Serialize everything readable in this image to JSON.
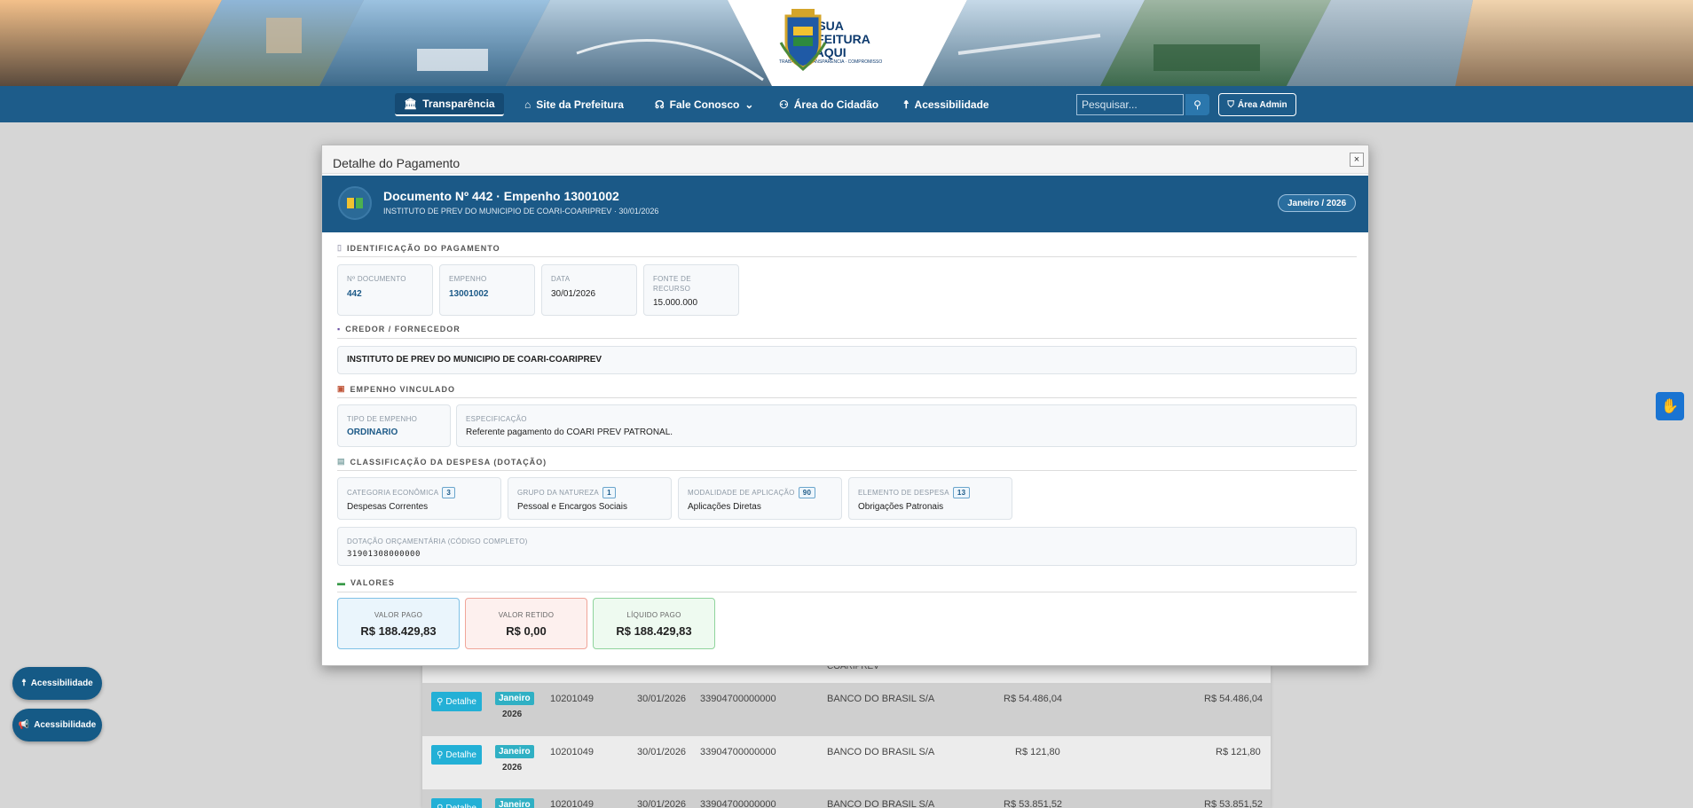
{
  "nav": {
    "items": [
      {
        "label": "Transparência",
        "icon": "bank-icon"
      },
      {
        "label": "Site da Prefeitura",
        "icon": "home-icon"
      },
      {
        "label": "Fale Conosco",
        "icon": "headset-icon"
      },
      {
        "label": "Área do Cidadão",
        "icon": "users-icon"
      },
      {
        "label": "Acessibilidade",
        "icon": "accessibility-icon"
      }
    ],
    "search_placeholder": "Pesquisar...",
    "admin_label": "Área Admin"
  },
  "logo": {
    "line1": "SUA",
    "line2": "PREFEITURA",
    "line3": "AQUI",
    "tagline": "TRABALHO · TRANSPARÊNCIA · COMPROMISSO"
  },
  "modal": {
    "title": "Detalhe do Pagamento",
    "close": "×",
    "header": {
      "title": "Documento Nº 442  ·  Empenho 13001002",
      "subtitle": "INSTITUTO DE PREV DO MUNICIPIO DE COARI-COARIPREV  ·  30/01/2026",
      "period": "Janeiro / 2026"
    },
    "identificacao": {
      "title": "IDENTIFICAÇÃO DO PAGAMENTO",
      "doc_label": "Nº DOCUMENTO",
      "doc_value": "442",
      "empenho_label": "EMPENHO",
      "empenho_value": "13001002",
      "data_label": "DATA",
      "data_value": "30/01/2026",
      "fonte_label_1": "FONTE DE",
      "fonte_label_2": "RECURSO",
      "fonte_value": "15.000.000"
    },
    "credor": {
      "title": "CREDOR / FORNECEDOR",
      "name": "INSTITUTO DE PREV DO MUNICIPIO DE COARI-COARIPREV"
    },
    "empenho": {
      "title": "EMPENHO VINCULADO",
      "tipo_label": "TIPO DE EMPENHO",
      "tipo_value": "ORDINARIO",
      "espec_label": "ESPECIFICAÇÃO",
      "espec_value": "Referente pagamento do COARI PREV PATRONAL."
    },
    "classificacao": {
      "title": "CLASSIFICAÇÃO DA DESPESA (DOTAÇÃO)",
      "cat_label": "CATEGORIA ECONÔMICA",
      "cat_code": "3",
      "cat_value": "Despesas Correntes",
      "grupo_label": "GRUPO DA NATUREZA",
      "grupo_code": "1",
      "grupo_value": "Pessoal e Encargos Sociais",
      "mod_label": "MODALIDADE DE APLICAÇÃO",
      "mod_code": "90",
      "mod_value": "Aplicações Diretas",
      "elem_label": "ELEMENTO DE DESPESA",
      "elem_code": "13",
      "elem_value": "Obrigações Patronais",
      "dotacao_label": "DOTAÇÃO ORÇAMENTÁRIA (CÓDIGO COMPLETO)",
      "dotacao_value": "31901308000000"
    },
    "valores": {
      "title": "VALORES",
      "pago_label": "VALOR PAGO",
      "pago_value": "R$ 188.429,83",
      "retido_label": "VALOR RETIDO",
      "retido_value": "R$ 0,00",
      "liquido_label": "LÍQUIDO PAGO",
      "liquido_value": "R$ 188.429,83"
    }
  },
  "background_table": {
    "partial_text": "COARIPREV",
    "detail_label": "Detalhe",
    "rows": [
      {
        "month": "Janeiro",
        "year": "2026",
        "doc": "10201049",
        "date": "30/01/2026",
        "dotacao": "33904700000000",
        "credor": "BANCO DO BRASIL S/A",
        "valor": "R$ 54.486,04",
        "liquido": "R$ 54.486,04"
      },
      {
        "month": "Janeiro",
        "year": "2026",
        "doc": "10201049",
        "date": "30/01/2026",
        "dotacao": "33904700000000",
        "credor": "BANCO DO BRASIL S/A",
        "valor": "R$ 121,80",
        "liquido": "R$ 121,80"
      },
      {
        "month": "Janeiro",
        "year": "",
        "doc": "10201049",
        "date": "30/01/2026",
        "dotacao": "33904700000000",
        "credor": "BANCO DO BRASIL S/A",
        "valor": "R$ 53.851,52",
        "liquido": "R$ 53.851,52"
      }
    ]
  },
  "floating": {
    "btn1": "Acessibilidade",
    "btn2": "Acessibilidade"
  }
}
